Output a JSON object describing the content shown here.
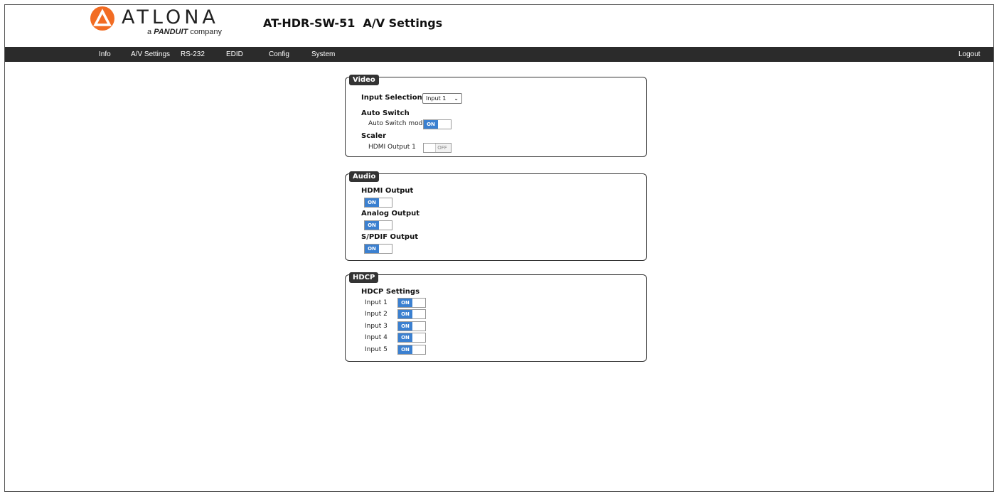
{
  "brand": {
    "logo_word": "ATLONA",
    "logo_sub_prefix": "a",
    "logo_sub_brand": "PANDUIT",
    "logo_sub_suffix": "company",
    "accent_color": "#f26c23"
  },
  "page_title": "AT-HDR-SW-51  A/V Settings",
  "nav": {
    "items": [
      "Info",
      "A/V Settings",
      "RS-232",
      "EDID",
      "Config",
      "System"
    ],
    "logout": "Logout"
  },
  "video": {
    "legend": "Video",
    "input_selection_label": "Input Selection",
    "input_selection_value": "Input 1",
    "auto_switch_heading": "Auto Switch",
    "auto_switch_mode_label": "Auto Switch mode",
    "auto_switch_mode_state": "ON",
    "scaler_heading": "Scaler",
    "hdmi_output_1_label": "HDMI Output 1",
    "hdmi_output_1_state": "OFF"
  },
  "audio": {
    "legend": "Audio",
    "hdmi_output_label": "HDMI Output",
    "hdmi_output_state": "ON",
    "analog_output_label": "Analog Output",
    "analog_output_state": "ON",
    "spdif_output_label": "S/PDIF Output",
    "spdif_output_state": "ON"
  },
  "hdcp": {
    "legend": "HDCP",
    "heading": "HDCP Settings",
    "inputs": [
      {
        "label": "Input 1",
        "state": "ON"
      },
      {
        "label": "Input 2",
        "state": "ON"
      },
      {
        "label": "Input 3",
        "state": "ON"
      },
      {
        "label": "Input 4",
        "state": "ON"
      },
      {
        "label": "Input 5",
        "state": "ON"
      }
    ]
  }
}
